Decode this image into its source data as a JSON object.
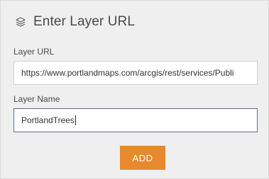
{
  "header": {
    "icon": "layers-icon",
    "title": "Enter Layer URL"
  },
  "form": {
    "url_label": "Layer URL",
    "url_value": "https://www.portlandmaps.com/arcgis/rest/services/Publi",
    "name_label": "Layer Name",
    "name_value": "PortlandTrees"
  },
  "actions": {
    "add_label": "ADD"
  },
  "colors": {
    "panel_bg": "#efefef",
    "button_bg": "#e8892e",
    "focused_border": "#5a6f8a"
  }
}
